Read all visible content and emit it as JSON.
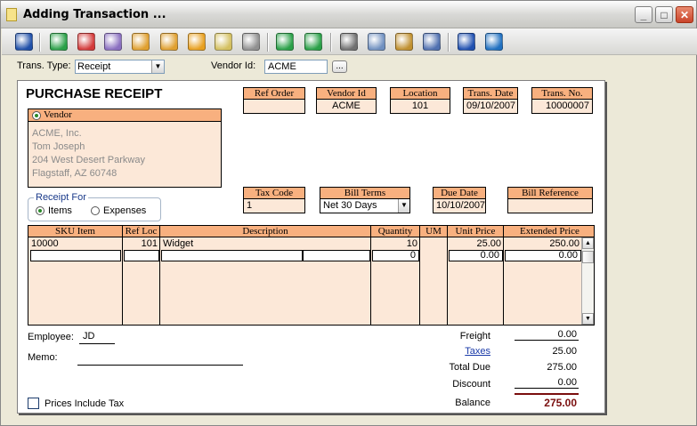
{
  "window": {
    "title": "Adding Transaction ...",
    "minimize": "_",
    "maximize": "□",
    "close": "✕"
  },
  "toolbar": {
    "items": [
      {
        "name": "save-icon",
        "color": "#1f4fa8"
      },
      {
        "name": "add-icon",
        "color": "#2aa048"
      },
      {
        "name": "delete-icon",
        "color": "#d33a3a"
      },
      {
        "name": "find-icon",
        "color": "#8a6fc0"
      },
      {
        "name": "filter-icon",
        "color": "#e0a030"
      },
      {
        "name": "add-item-icon",
        "color": "#e0a030"
      },
      {
        "name": "copy-icon",
        "color": "#e8a020"
      },
      {
        "name": "list-icon",
        "color": "#d4c060"
      },
      {
        "name": "calculator-icon",
        "color": "#909090"
      },
      {
        "name": "refresh-icon",
        "color": "#2aa048"
      },
      {
        "name": "po-icon",
        "color": "#2aa048"
      },
      {
        "name": "print-icon",
        "color": "#707070"
      },
      {
        "name": "preview-icon",
        "color": "#7090c0"
      },
      {
        "name": "package-icon",
        "color": "#c09030"
      },
      {
        "name": "notes-icon",
        "color": "#5070b0"
      },
      {
        "name": "help-icon",
        "color": "#2050b0"
      },
      {
        "name": "exit-icon",
        "color": "#2070c0"
      }
    ]
  },
  "header": {
    "trans_type_label": "Trans. Type:",
    "trans_type_value": "Receipt",
    "vendor_id_label": "Vendor Id:",
    "vendor_id_value": "ACME",
    "lookup_label": "..."
  },
  "doc": {
    "title": "PURCHASE RECEIPT",
    "fields": {
      "ref_order": {
        "label": "Ref Order",
        "value": ""
      },
      "vendor_id": {
        "label": "Vendor Id",
        "value": "ACME"
      },
      "location": {
        "label": "Location",
        "value": "101"
      },
      "trans_date": {
        "label": "Trans. Date",
        "value": "09/10/2007"
      },
      "trans_no": {
        "label": "Trans. No.",
        "value": "10000007"
      },
      "tax_code": {
        "label": "Tax Code",
        "value": "1"
      },
      "bill_terms": {
        "label": "Bill Terms",
        "value": "Net 30 Days"
      },
      "due_date": {
        "label": "Due Date",
        "value": "10/10/2007"
      },
      "bill_reference": {
        "label": "Bill Reference",
        "value": ""
      }
    },
    "vendor": {
      "label": "Vendor",
      "address": [
        "ACME, Inc.",
        "Tom Joseph",
        "204 West Desert Parkway",
        "Flagstaff, AZ 60748"
      ]
    },
    "receipt_for": {
      "label": "Receipt For",
      "items": "Items",
      "expenses": "Expenses",
      "selected": "Items"
    },
    "grid": {
      "columns": [
        "SKU Item",
        "Ref Loc",
        "Description",
        "Quantity",
        "UM",
        "Unit Price",
        "Extended Price"
      ],
      "rows": [
        {
          "sku": "10000",
          "loc": "101",
          "desc": "Widget",
          "qty": "10",
          "um": "",
          "unit": "25.00",
          "ext": "250.00"
        },
        {
          "sku": "",
          "loc": "",
          "desc": "",
          "qty": "0",
          "um": "",
          "unit": "0.00",
          "ext": "0.00"
        }
      ]
    },
    "employee_label": "Employee:",
    "employee_value": "JD",
    "memo_label": "Memo:",
    "memo_value": "",
    "prices_include_tax": "Prices Include Tax",
    "totals": {
      "freight_label": "Freight",
      "freight": "0.00",
      "taxes_label": "Taxes",
      "taxes": "25.00",
      "total_due_label": "Total Due",
      "total_due": "275.00",
      "discount_label": "Discount",
      "discount": "0.00",
      "balance_label": "Balance",
      "balance": "275.00"
    }
  },
  "colors": {
    "header_orange": "#f8b07f",
    "cell_peach": "#fce8d8",
    "balance_red": "#7a0e0e"
  }
}
